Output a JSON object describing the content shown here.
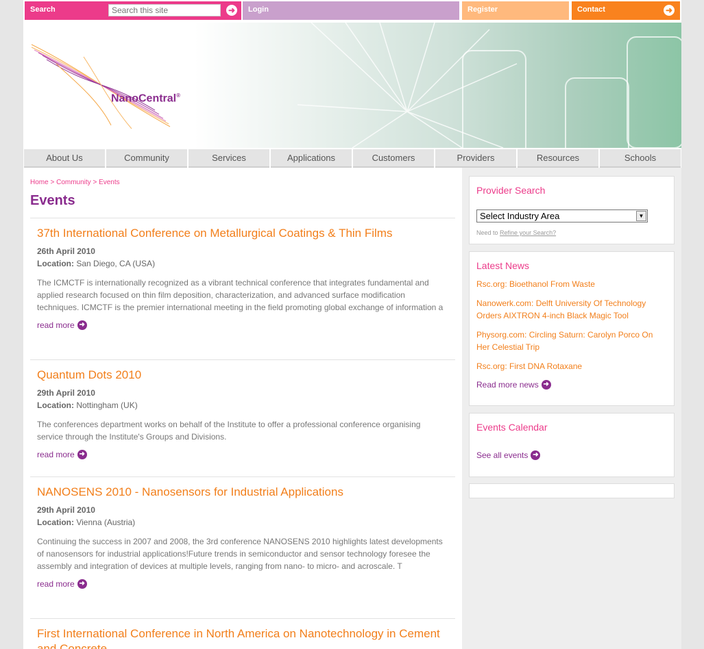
{
  "topbar": {
    "search_label": "Search",
    "search_placeholder": "Search this site",
    "login_label": "Login",
    "register_label": "Register",
    "contact_label": "Contact"
  },
  "brand": {
    "name": "NanoCentral",
    "reg": "®"
  },
  "colors": {
    "pink": "#ec3b8a",
    "purple": "#8a2c8e",
    "orange": "#f27f1b",
    "lilac": "#c9a0cc",
    "peach": "#ffb97d"
  },
  "nav": [
    "About Us",
    "Community",
    "Services",
    "Applications",
    "Customers",
    "Providers",
    "Resources",
    "Schools"
  ],
  "breadcrumb": {
    "home": "Home",
    "community": "Community",
    "events": "Events",
    "sep": ">"
  },
  "page_title": "Events",
  "location_label": "Location:",
  "read_more": "read more",
  "events": [
    {
      "title": "37th International Conference on Metallurgical Coatings & Thin Films",
      "date": "26th April 2010",
      "location": "San Diego, CA (USA)",
      "desc": "The ICMCTF is internationally recognized as a vibrant technical conference that integrates fundamental and applied research focused on thin film deposition, characterization, and advanced surface modification techniques. ICMCTF is the premier international meeting in the field promoting global exchange of information a"
    },
    {
      "title": "Quantum Dots 2010",
      "date": "29th April 2010",
      "location": "Nottingham (UK)",
      "desc": "The conferences department works on behalf of the Institute to offer a professional conference organising service through the Institute's Groups and Divisions."
    },
    {
      "title": "NANOSENS 2010 - Nanosensors for Industrial Applications",
      "date": "29th April 2010",
      "location": "Vienna (Austria)",
      "desc": "Continuing the success in 2007 and 2008, the 3rd conference NANOSENS 2010 highlights latest developments of nanosensors for industrial applications!Future trends in semiconductor and sensor technology foresee the assembly and integration of devices at multiple levels, ranging from nano- to micro- and  acroscale. T"
    },
    {
      "title": "First International Conference in North America on Nanotechnology in Cement and Concrete"
    }
  ],
  "sidebar": {
    "provider_search": {
      "title": "Provider Search",
      "select_value": "Select Industry Area",
      "refine_prefix": "Need to",
      "refine_link": "Refine your Search?"
    },
    "latest_news": {
      "title": "Latest News",
      "items": [
        "Rsc.org: Bioethanol From Waste",
        "Nanowerk.com: Delft University Of Technology Orders AIXTRON 4-inch Black Magic Tool",
        "Physorg.com: Circling Saturn: Carolyn Porco On Her Celestial Trip",
        "Rsc.org: First DNA Rotaxane"
      ],
      "more": "Read more news"
    },
    "events_calendar": {
      "title": "Events Calendar",
      "see_all": "See all events"
    }
  }
}
